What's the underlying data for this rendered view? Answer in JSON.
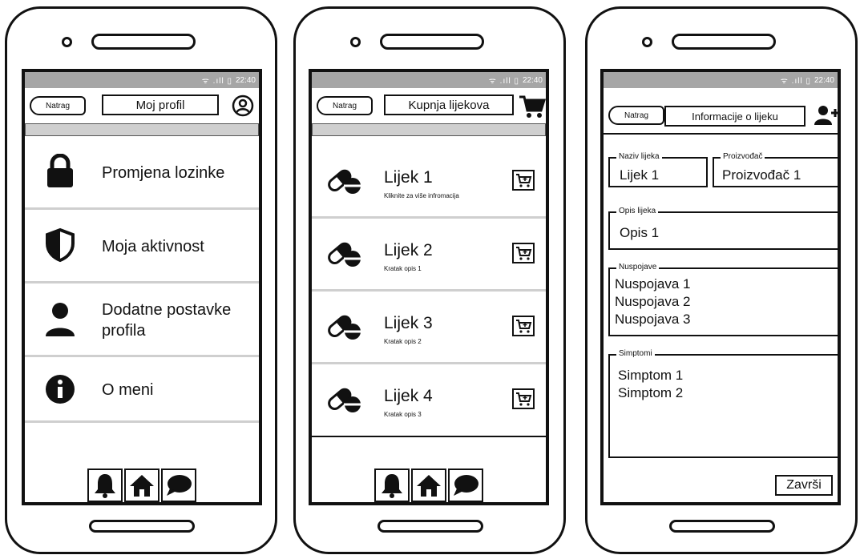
{
  "statusbar": {
    "icons": "ᯤ .ıll ▯",
    "time": "22:40"
  },
  "profile_screen": {
    "back_label": "Natrag",
    "title": "Moj profil",
    "menu": [
      {
        "label": "Promjena lozinke",
        "icon": "lock-icon"
      },
      {
        "label": "Moja aktivnost",
        "icon": "shield-icon"
      },
      {
        "label": "Dodatne postavke profila",
        "icon": "person-icon"
      },
      {
        "label": "O meni",
        "icon": "info-icon"
      }
    ]
  },
  "purchase_screen": {
    "back_label": "Natrag",
    "title": "Kupnja lijekova",
    "drugs": [
      {
        "name": "Lijek 1",
        "desc": "Kliknite za više infromacija"
      },
      {
        "name": "Lijek 2",
        "desc": "Kratak opis 1"
      },
      {
        "name": "Lijek 3",
        "desc": "Kratak opis 2"
      },
      {
        "name": "Lijek 4",
        "desc": "Kratak opis 3"
      }
    ]
  },
  "info_screen": {
    "back_label": "Natrag",
    "title": "Informacije o lijeku",
    "name_label": "Naziv lijeka",
    "name_value": "Lijek 1",
    "maker_label": "Proizvođač",
    "maker_value": "Proizvođač 1",
    "desc_label": "Opis lijeka",
    "desc_value": "Opis 1",
    "side_label": "Nuspojave",
    "side_effects": [
      "Nuspojava 1",
      "Nuspojava 2",
      "Nuspojava 3"
    ],
    "symptoms_label": "Simptomi",
    "symptoms": [
      "Simptom 1",
      "Simptom 2"
    ],
    "finish_label": "Završi"
  },
  "nav": [
    "bell-icon",
    "home-icon",
    "chat-icon"
  ]
}
